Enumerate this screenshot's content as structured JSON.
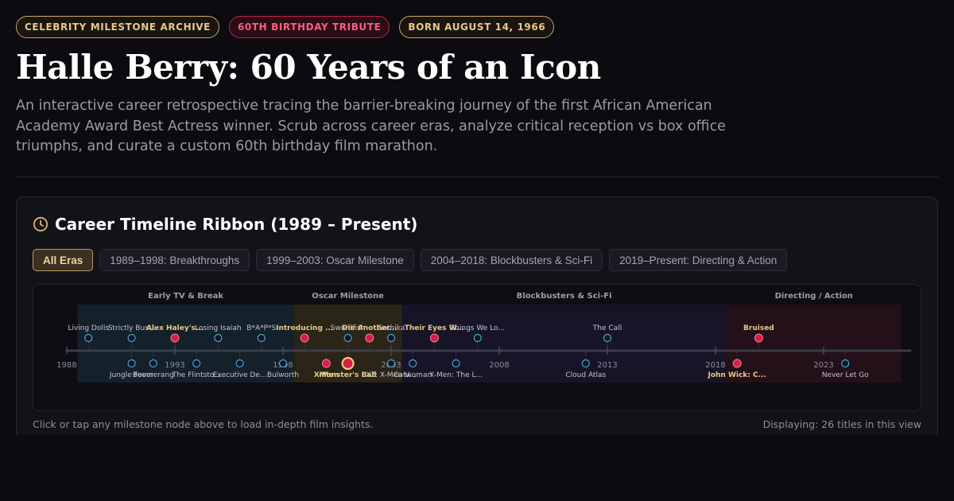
{
  "badges": [
    {
      "label": "CELEBRITY MILESTONE ARCHIVE",
      "style": "gold"
    },
    {
      "label": "60TH BIRTHDAY TRIBUTE",
      "style": "red"
    },
    {
      "label": "BORN AUGUST 14, 1966",
      "style": "gold"
    }
  ],
  "header": {
    "title": "Halle Berry: 60 Years of an Icon",
    "subtitle": "An interactive career retrospective tracing the barrier-breaking journey of the first African American Academy Award Best Actress winner. Scrub across career eras, analyze critical reception vs box office triumphs, and curate a custom 60th birthday film marathon."
  },
  "timeline": {
    "title": "Career Timeline Ribbon (1989 – Present)",
    "icon": "clock-icon",
    "tabs": [
      "All Eras",
      "1989–1998: Breakthroughs",
      "1999–2003: Oscar Milestone",
      "2004–2018: Blockbusters & Sci-Fi",
      "2019–Present: Directing & Action"
    ],
    "active_tab": 0,
    "eras": [
      {
        "label": "Early TV & Break",
        "start": 1988.5,
        "end": 1998.5,
        "color": "#14202a"
      },
      {
        "label": "Oscar Milestone",
        "start": 1998.5,
        "end": 2003.5,
        "color": "#2a2517"
      },
      {
        "label": "Blockbusters & Sci-Fi",
        "start": 2003.5,
        "end": 2018.5,
        "color": "#181428"
      },
      {
        "label": "Directing / Action",
        "start": 2018.5,
        "end": 2026.6,
        "color": "#241018"
      }
    ],
    "axis_min": 1988,
    "axis_max": 2027,
    "tick_labels": [
      "1988",
      "1993",
      "1998",
      "2003",
      "2008",
      "2013",
      "2018",
      "2023"
    ],
    "films_above": [
      {
        "year": 1989,
        "label": "Living Dolls",
        "highlight": false
      },
      {
        "year": 1991,
        "label": "Strictly Bus...",
        "highlight": false
      },
      {
        "year": 1993,
        "label": "Alex Haley's...",
        "highlight": true
      },
      {
        "year": 1995,
        "label": "Losing Isaiah",
        "highlight": false
      },
      {
        "year": 1997,
        "label": "B*A*P*S",
        "highlight": false
      },
      {
        "year": 1999,
        "label": "Introducing ...",
        "highlight": true
      },
      {
        "year": 2001,
        "label": "Swordfish",
        "highlight": false
      },
      {
        "year": 2002,
        "label": "Die Another...",
        "highlight": true
      },
      {
        "year": 2003,
        "label": "Gothika",
        "highlight": false
      },
      {
        "year": 2005,
        "label": "Their Eyes W...",
        "highlight": true
      },
      {
        "year": 2007,
        "label": "Things We Lo...",
        "highlight": false
      },
      {
        "year": 2013,
        "label": "The Call",
        "highlight": false
      },
      {
        "year": 2020,
        "label": "Bruised",
        "highlight": true
      }
    ],
    "films_below": [
      {
        "year": 1991,
        "label": "Jungle Fever",
        "highlight": false
      },
      {
        "year": 1992,
        "label": "Boomerang",
        "highlight": false
      },
      {
        "year": 1994,
        "label": "The Flintsto...",
        "highlight": false
      },
      {
        "year": 1996,
        "label": "Executive De...",
        "highlight": false
      },
      {
        "year": 1998,
        "label": "Bulworth",
        "highlight": false
      },
      {
        "year": 2000,
        "label": "X-Men",
        "highlight": true
      },
      {
        "year": 2001,
        "label": "Monster's Ball",
        "highlight": true,
        "featured": true
      },
      {
        "year": 2003,
        "label": "X2: X-Men U...",
        "highlight": false
      },
      {
        "year": 2004,
        "label": "Catwoman",
        "highlight": false
      },
      {
        "year": 2006,
        "label": "X-Men: The L...",
        "highlight": false
      },
      {
        "year": 2012,
        "label": "Cloud Atlas",
        "highlight": false
      },
      {
        "year": 2019,
        "label": "John Wick: C...",
        "highlight": true
      },
      {
        "year": 2024,
        "label": "Never Let Go",
        "highlight": false
      }
    ],
    "footer_hint": "Click or tap any milestone node above to load in-depth film insights.",
    "footer_count": "Displaying: 26 titles in this view"
  },
  "colors": {
    "accent_gold": "#e9c88a",
    "accent_red": "#d61f45",
    "node_blue": "#4aa3d8"
  }
}
